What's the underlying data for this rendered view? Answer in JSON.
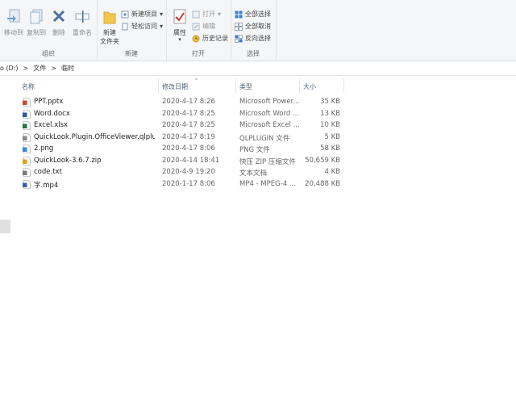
{
  "ribbon": {
    "organize": {
      "label": "组织",
      "move_to": "移动到",
      "copy_to": "复制到",
      "delete": "删除",
      "rename": "重命名"
    },
    "new": {
      "label": "新建",
      "new_folder": "新建\n文件夹",
      "new_item": "新建项目",
      "easy_access": "轻松访问"
    },
    "open": {
      "label": "打开",
      "properties": "属性",
      "open": "打开",
      "edit": "编辑",
      "history": "历史记录"
    },
    "select": {
      "label": "选择",
      "select_all": "全部选择",
      "select_none": "全部取消",
      "invert": "反向选择"
    }
  },
  "address": {
    "drive": "o (D:)",
    "sep": ">",
    "folder1": "文件",
    "folder2": "临时"
  },
  "columns": {
    "name": "名称",
    "date": "修改日期",
    "type": "类型",
    "size": "大小"
  },
  "files": [
    {
      "name": "PPT.pptx",
      "date": "2020-4-17 8:26",
      "type": "Microsoft Power...",
      "size": "35 KB",
      "icon": "powerpoint-icon",
      "color": "#d24726"
    },
    {
      "name": "Word.docx",
      "date": "2020-4-17 8:25",
      "type": "Microsoft Word ...",
      "size": "13 KB",
      "icon": "word-icon",
      "color": "#2b579a"
    },
    {
      "name": "Excel.xlsx",
      "date": "2020-4-17 8:25",
      "type": "Microsoft Excel ...",
      "size": "10 KB",
      "icon": "excel-icon",
      "color": "#217346"
    },
    {
      "name": "QuickLook.Plugin.OfficeViewer.qlplu...",
      "date": "2020-4-17 8:19",
      "type": "QLPLUGIN 文件",
      "size": "5 KB",
      "icon": "file-icon",
      "color": "#8a8a8a"
    },
    {
      "name": "2.png",
      "date": "2020-4-17 8:06",
      "type": "PNG 文件",
      "size": "58 KB",
      "icon": "image-icon",
      "color": "#2e8bd8"
    },
    {
      "name": "QuickLook-3.6.7.zip",
      "date": "2020-4-14 18:41",
      "type": "快压 ZIP 压缩文件",
      "size": "50,659 KB",
      "icon": "zip-icon",
      "color": "#e0a020"
    },
    {
      "name": "code.txt",
      "date": "2020-4-9 19:20",
      "type": "文本文档",
      "size": "4 KB",
      "icon": "text-file-icon",
      "color": "#777777"
    },
    {
      "name": "字.mp4",
      "date": "2020-1-17 8:06",
      "type": "MP4 - MPEG-4 ...",
      "size": "20,488 KB",
      "icon": "video-icon",
      "color": "#3a5fb0"
    }
  ]
}
